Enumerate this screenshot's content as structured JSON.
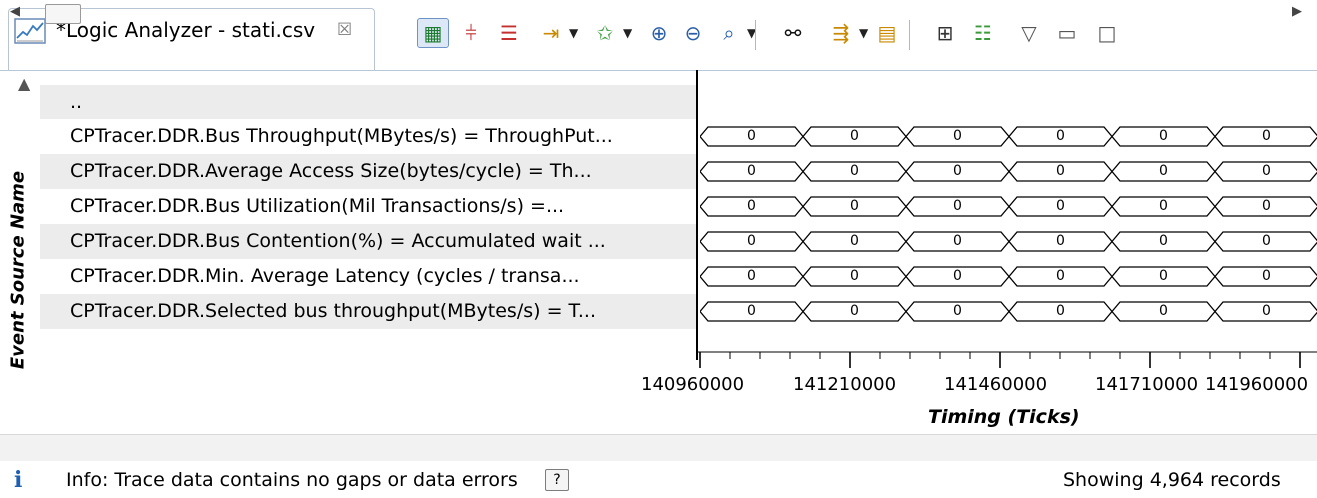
{
  "tab": {
    "title": "*Logic Analyzer - stati.csv",
    "icon": "logic-analyzer-icon",
    "close_glyph": "☒"
  },
  "toolbar": {
    "buttons": [
      {
        "name": "signal-layout-icon",
        "glyph": "▦",
        "pressed": true,
        "color": "#1a7a2d"
      },
      {
        "name": "cursor-sync-icon",
        "glyph": "⫩",
        "color": "#c23030"
      },
      {
        "name": "marker-icon",
        "glyph": "☰",
        "color": "#c23030"
      },
      {
        "name": "jump-to-icon",
        "glyph": "⇥",
        "color": "#c98a00"
      },
      {
        "name": "bookmark-icon",
        "glyph": "✩",
        "color": "#3a9a3a"
      },
      {
        "name": "zoom-in-icon",
        "glyph": "⊕",
        "color": "#2a5fa8"
      },
      {
        "name": "zoom-out-icon",
        "glyph": "⊖",
        "color": "#2a5fa8"
      },
      {
        "name": "zoom-fit-icon",
        "glyph": "⌕",
        "color": "#2a5fa8"
      },
      {
        "name": "find-icon",
        "glyph": "⚯",
        "color": "#111111"
      },
      {
        "name": "filter-icon",
        "glyph": "⇶",
        "color": "#c98a00"
      },
      {
        "name": "lock-layout-icon",
        "glyph": "▤",
        "color": "#c98a00"
      },
      {
        "name": "tree-view-icon",
        "glyph": "⊞",
        "color": "#333333"
      },
      {
        "name": "list-view-icon",
        "glyph": "☷",
        "color": "#3a9a3a"
      },
      {
        "name": "view-menu-icon",
        "glyph": "▽",
        "color": "#555555"
      },
      {
        "name": "minimize-icon",
        "glyph": "▭",
        "color": "#555555"
      },
      {
        "name": "maximize-icon",
        "glyph": "□",
        "color": "#555555"
      }
    ]
  },
  "left_panel": {
    "vertical_label": "Event Source Name",
    "parent_entry": "..",
    "rows": [
      "CPTracer.DDR.Bus Throughput(MBytes/s) = ThroughPut...",
      "CPTracer.DDR.Average Access Size(bytes/cycle) = Th...",
      "CPTracer.DDR.Bus Utilization(Mil Transactions/s) =...",
      "CPTracer.DDR.Bus Contention(%) = Accumulated wait ...",
      "CPTracer.DDR.Min. Average Latency (cycles / transa...",
      "CPTracer.DDR.Selected bus throughput(MBytes/s) = T..."
    ]
  },
  "waveform": {
    "cell_value": "0",
    "cells_per_row": 6
  },
  "axis": {
    "ticks": [
      "140960000",
      "141210000",
      "141460000",
      "141710000",
      "141960000"
    ],
    "title": "Timing (Ticks)"
  },
  "status": {
    "info_glyph": "i",
    "message": "Info: Trace data contains no gaps or data errors",
    "help_label": "?",
    "records": "Showing 4,964 records"
  },
  "colors": {
    "row_alt": "#ececec",
    "info_blue": "#1d5fb0"
  }
}
